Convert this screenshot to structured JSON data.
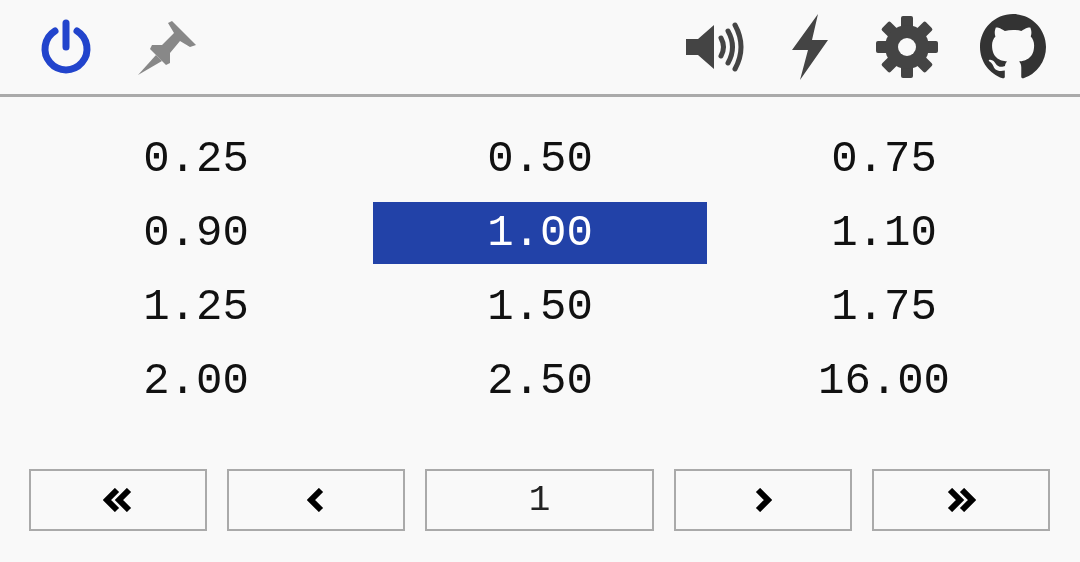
{
  "toolbar": {
    "power": {
      "on": true
    },
    "pin": {
      "on": false
    }
  },
  "values": [
    {
      "label": "0.25",
      "selected": false
    },
    {
      "label": "0.50",
      "selected": false
    },
    {
      "label": "0.75",
      "selected": false
    },
    {
      "label": "0.90",
      "selected": false
    },
    {
      "label": "1.00",
      "selected": true
    },
    {
      "label": "1.10",
      "selected": false
    },
    {
      "label": "1.25",
      "selected": false
    },
    {
      "label": "1.50",
      "selected": false
    },
    {
      "label": "1.75",
      "selected": false
    },
    {
      "label": "2.00",
      "selected": false
    },
    {
      "label": "2.50",
      "selected": false
    },
    {
      "label": "16.00",
      "selected": false
    }
  ],
  "pager": {
    "page": "1"
  }
}
